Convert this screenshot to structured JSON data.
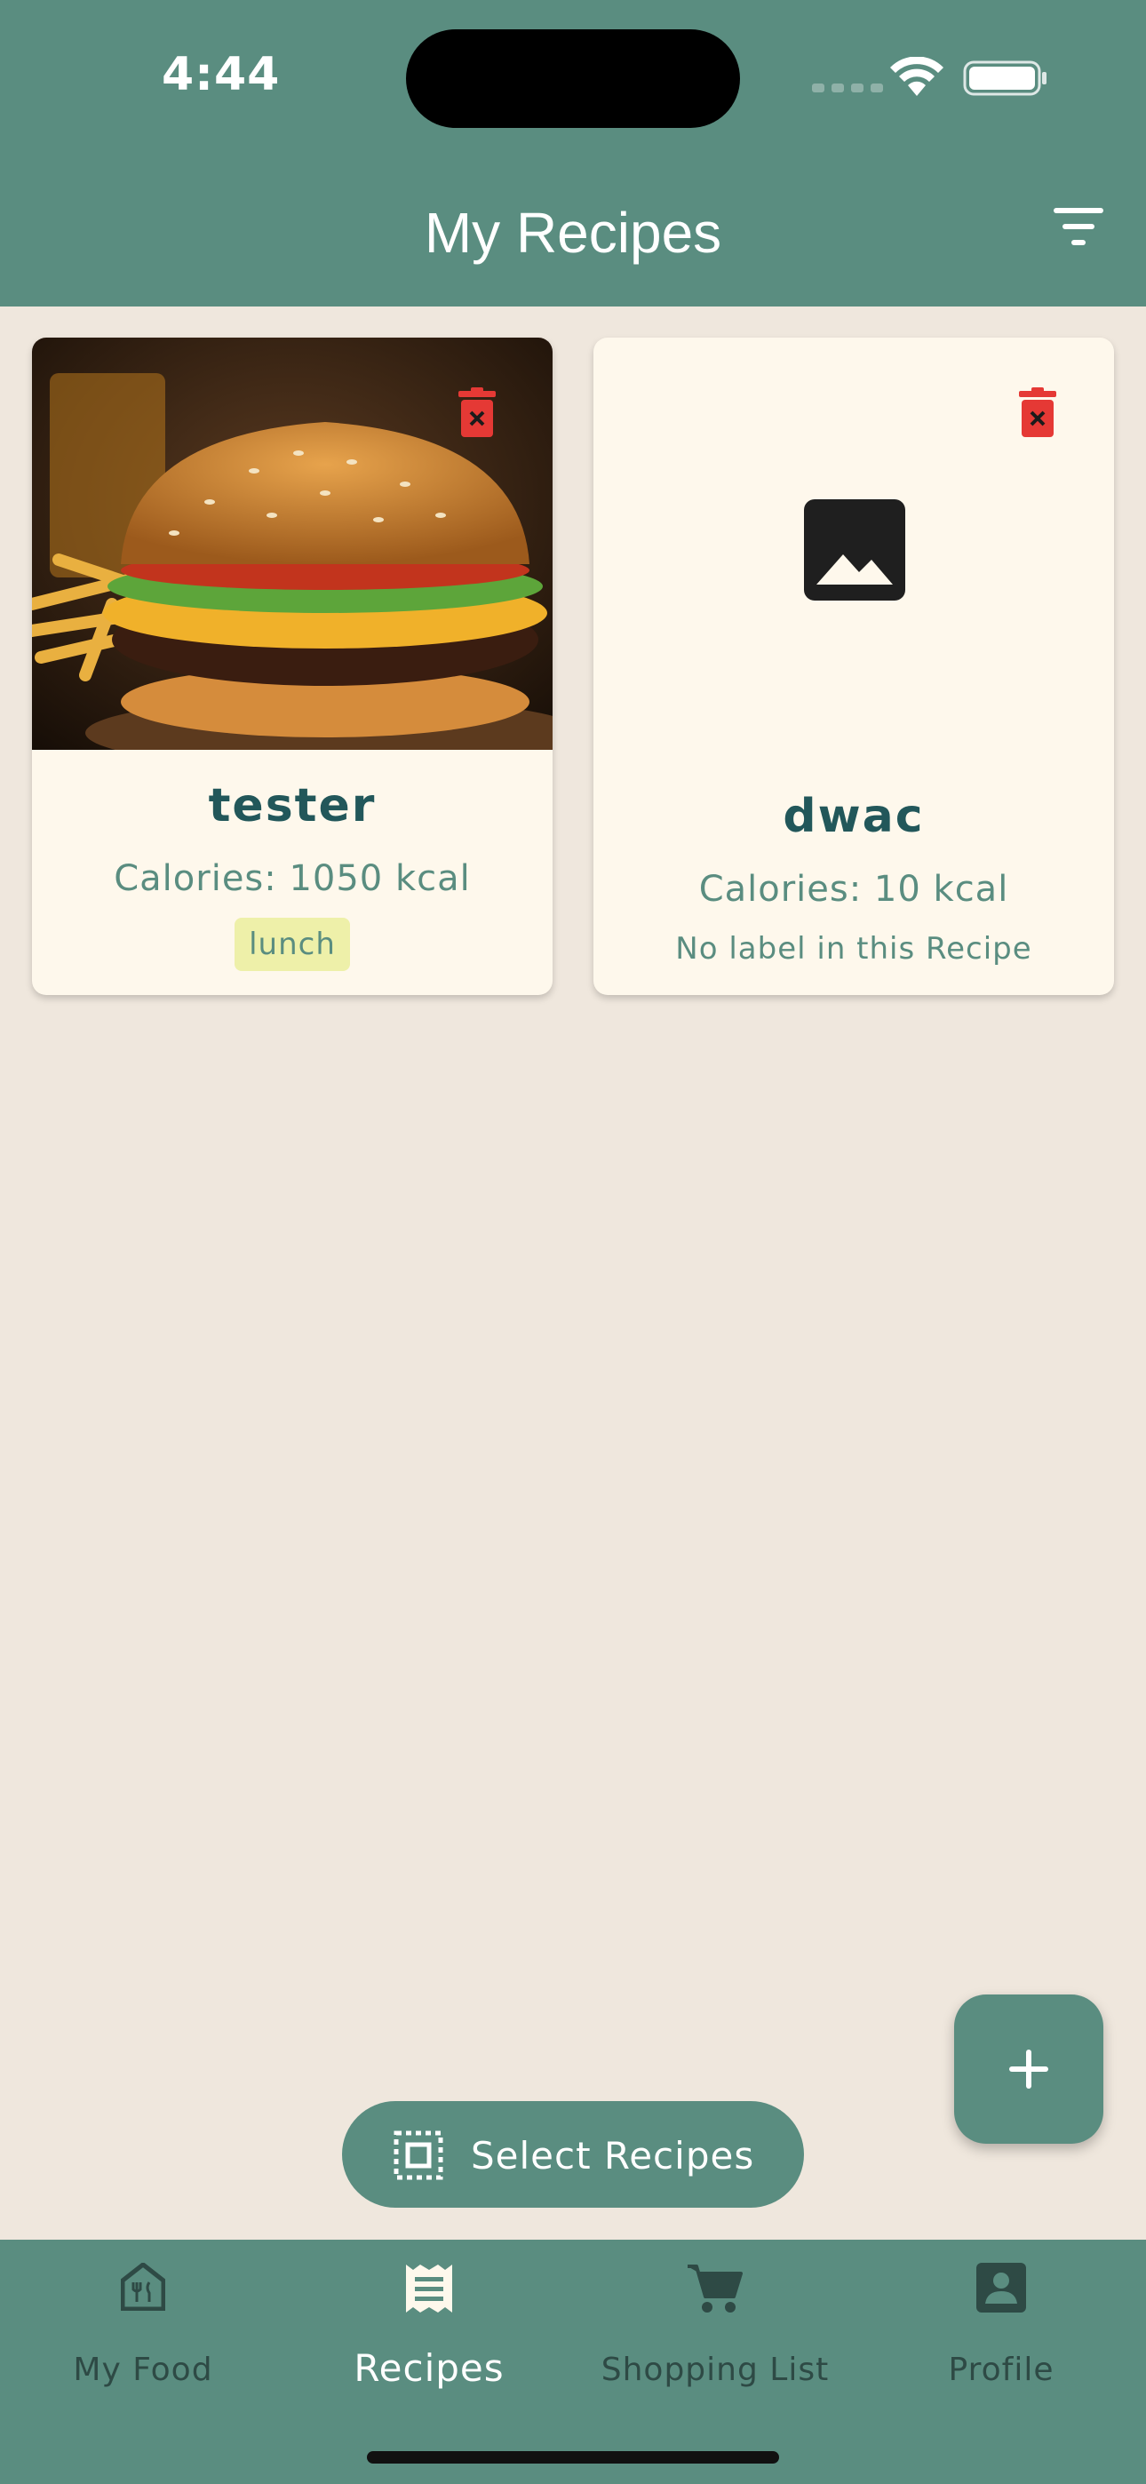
{
  "status_bar": {
    "time": "4:44"
  },
  "header": {
    "title": "My Recipes"
  },
  "recipes": [
    {
      "name": "tester",
      "calories": "Calories: 1050 kcal",
      "label": "lunch"
    },
    {
      "name": "dwac",
      "calories": "Calories: 10 kcal",
      "no_label_text": "No label in this Recipe"
    }
  ],
  "select_button": {
    "label": "Select Recipes"
  },
  "bottom_nav": [
    {
      "label": "My Food",
      "icon": "home-utensils-icon"
    },
    {
      "label": "Recipes",
      "icon": "receipt-icon",
      "active": true
    },
    {
      "label": "Shopping List",
      "icon": "cart-icon"
    },
    {
      "label": "Profile",
      "icon": "person-badge-icon"
    }
  ],
  "colors": {
    "primary": "#5a8d80",
    "background": "#efe7dd",
    "card": "#fef8ec",
    "title_text": "#22575a",
    "delete": "#e53935",
    "label_chip": "#eef0a9"
  }
}
